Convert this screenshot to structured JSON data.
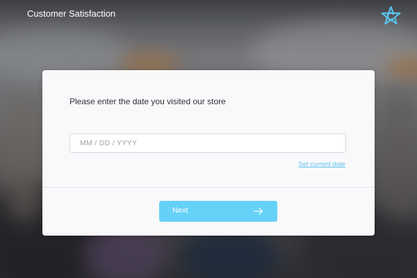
{
  "header": {
    "title": "Customer Satisfaction",
    "logo_icon": "star-logo-icon",
    "logo_color": "#58c4ee"
  },
  "card": {
    "prompt": "Please enter the date you visited our store",
    "date_input": {
      "value": "",
      "placeholder": "MM / DD / YYYY"
    },
    "set_current_date_link": "Set current date",
    "next_button": {
      "label": "Next",
      "icon": "arrow-right-icon",
      "color": "#66d1f7"
    },
    "accent_color": "#5fc2ec"
  }
}
